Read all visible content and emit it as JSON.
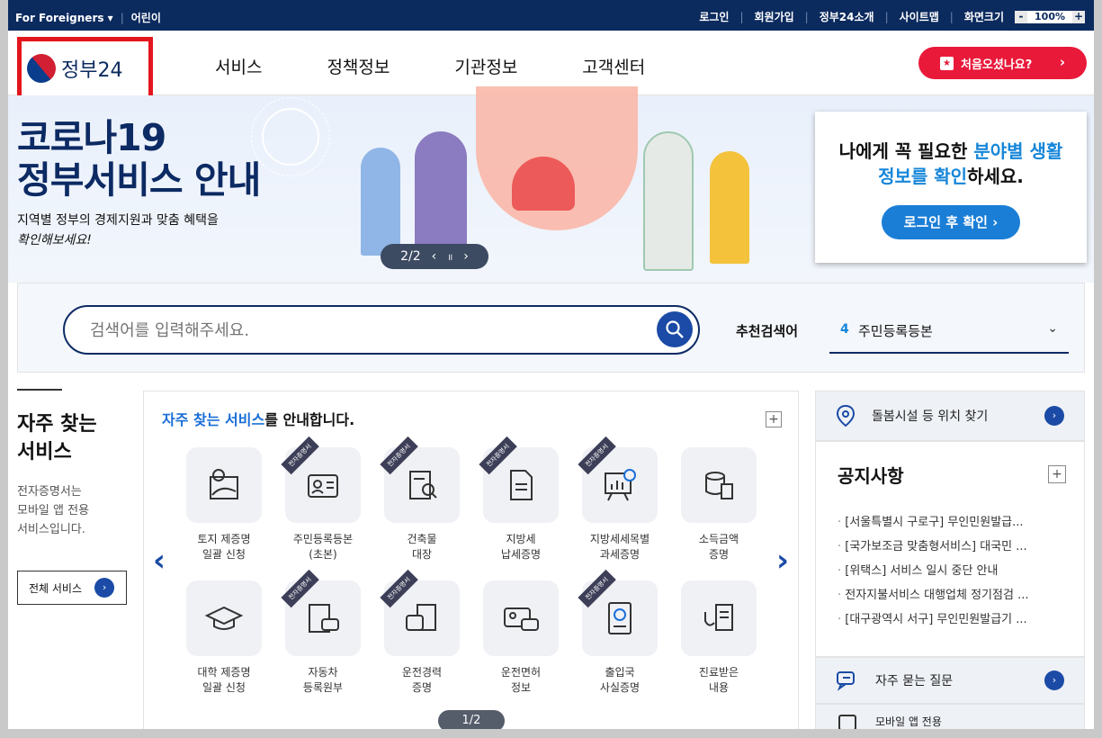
{
  "topbar": {
    "foreigners": "For Foreigners ▾",
    "kids": "어린이",
    "login": "로그인",
    "signup": "회원가입",
    "about": "정부24소개",
    "sitemap": "사이트맵",
    "screen_size": "화면크기",
    "zoom_minus": "-",
    "zoom_value": "100%",
    "zoom_plus": "+"
  },
  "header": {
    "logo": "정부24",
    "nav": [
      "서비스",
      "정책정보",
      "기관정보",
      "고객센터"
    ],
    "first_visit": "처음오셨나요?",
    "first_visit_arrow": "›"
  },
  "banner": {
    "title_line1": "코로나19",
    "title_line2": "정부서비스 안내",
    "desc_line1": "지역별 정부의 경제지원과 맞춤 혜택을",
    "desc_line2": "확인해보세요!",
    "pager": "2/2",
    "prev": "‹",
    "pause": "॥",
    "next": "›"
  },
  "login_card": {
    "line1_a": "나에게 꼭 필요한 ",
    "line1_b": "분야별 생활",
    "line2_a": "정보를 확인",
    "line2_b": "하세요.",
    "button": "로그인 후 확인 ›"
  },
  "search": {
    "placeholder": "검색어를 입력해주세요.",
    "recommend_label": "추천검색어",
    "recommend_num": "4",
    "recommend_value": "주민등록등본",
    "chevron": "⌄"
  },
  "left": {
    "title_line1": "자주 찾는",
    "title_line2": "서비스",
    "sub_line1": "전자증명서는",
    "sub_line2": "모바일 앱 전용",
    "sub_line3": "서비스입니다.",
    "all_button": "전체 서비스",
    "all_arrow": "›"
  },
  "services": {
    "heading_hl": "자주 찾는 서비스",
    "heading_rest": "를 안내합니다.",
    "plus": "+",
    "prev": "‹",
    "next": "›",
    "pager": "1/2",
    "ribbon": "전자증명서",
    "items": [
      {
        "line1": "토지 제증명",
        "line2": "일괄 신청"
      },
      {
        "line1": "주민등록등본",
        "line2": "(초본)"
      },
      {
        "line1": "건축물",
        "line2": "대장"
      },
      {
        "line1": "지방세",
        "line2": "납세증명"
      },
      {
        "line1": "지방세세목별",
        "line2": "과세증명"
      },
      {
        "line1": "소득금액",
        "line2": "증명"
      },
      {
        "line1": "대학 제증명",
        "line2": "일괄 신청"
      },
      {
        "line1": "자동차",
        "line2": "등록원부"
      },
      {
        "line1": "운전경력",
        "line2": "증명"
      },
      {
        "line1": "운전면허",
        "line2": "정보"
      },
      {
        "line1": "출입국",
        "line2": "사실증명"
      },
      {
        "line1": "진료받은",
        "line2": "내용"
      }
    ]
  },
  "right": {
    "location": "돌봄시설 등 위치 찾기",
    "go": "›",
    "notice_title": "공지사항",
    "notice_plus": "+",
    "notices": [
      "[서울특별시 구로구] 무인민원발급...",
      "[국가보조금 맞춤형서비스] 대국민 ...",
      "[위택스] 서비스 일시 중단 안내",
      "전자지불서비스 대행업체 정기점검 ...",
      "[대구광역시 서구] 무인민원발급기 ..."
    ],
    "faq": "자주 묻는 질문",
    "mobile": "모바일 앱 전용"
  },
  "colors": {
    "navy": "#0b2a5e",
    "accent_red": "#e9193a",
    "accent_blue": "#1b4ba6"
  }
}
